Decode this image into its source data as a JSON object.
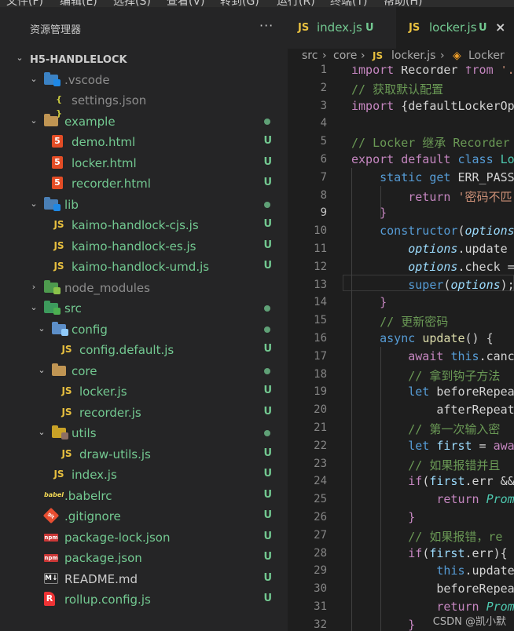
{
  "menubar": [
    "文件(F)",
    "编辑(E)",
    "选择(S)",
    "查看(V)",
    "转到(G)",
    "运行(R)",
    "终端(T)",
    "帮助(H)"
  ],
  "sidebar": {
    "title": "资源管理器",
    "more": "···",
    "root": "H5-HANDLELOCK",
    "items": [
      {
        "label": ".vscode",
        "status": ""
      },
      {
        "label": "settings.json",
        "status": ""
      },
      {
        "label": "example",
        "status": ""
      },
      {
        "label": "demo.html",
        "status": "U"
      },
      {
        "label": "locker.html",
        "status": "U"
      },
      {
        "label": "recorder.html",
        "status": "U"
      },
      {
        "label": "lib",
        "status": ""
      },
      {
        "label": "kaimo-handlock-cjs.js",
        "status": "U"
      },
      {
        "label": "kaimo-handlock-es.js",
        "status": "U"
      },
      {
        "label": "kaimo-handlock-umd.js",
        "status": "U"
      },
      {
        "label": "node_modules",
        "status": ""
      },
      {
        "label": "src",
        "status": ""
      },
      {
        "label": "config",
        "status": ""
      },
      {
        "label": "config.default.js",
        "status": "U"
      },
      {
        "label": "core",
        "status": ""
      },
      {
        "label": "locker.js",
        "status": "U"
      },
      {
        "label": "recorder.js",
        "status": "U"
      },
      {
        "label": "utils",
        "status": ""
      },
      {
        "label": "draw-utils.js",
        "status": "U"
      },
      {
        "label": "index.js",
        "status": "U"
      },
      {
        "label": ".babelrc",
        "status": "U"
      },
      {
        "label": ".gitignore",
        "status": "U"
      },
      {
        "label": "package-lock.json",
        "status": "U"
      },
      {
        "label": "package.json",
        "status": "U"
      },
      {
        "label": "README.md",
        "status": "U"
      },
      {
        "label": "rollup.config.js",
        "status": "U"
      }
    ]
  },
  "icons": {
    "js": "JS",
    "json": "{ }",
    "html": "5",
    "babel": "babel",
    "git": "git",
    "npm": "npm",
    "md": "M↓",
    "rollup": "R"
  },
  "tabs": [
    {
      "icon": "JS",
      "name": "index.js",
      "status": "U"
    },
    {
      "icon": "JS",
      "name": "locker.js",
      "status": "U",
      "close": "×"
    }
  ],
  "breadcrumb": {
    "p1": "src",
    "p2": "core",
    "p3": "locker.js",
    "p4": "Locker",
    "sep": "›",
    "js": "JS"
  },
  "editor": {
    "lines": [
      "1",
      "2",
      "3",
      "4",
      "5",
      "6",
      "7",
      "8",
      "9",
      "10",
      "11",
      "12",
      "13",
      "14",
      "15",
      "16",
      "17",
      "18",
      "19",
      "20",
      "21",
      "22",
      "23",
      "24",
      "25",
      "26",
      "27",
      "28",
      "29",
      "30",
      "31",
      "32"
    ],
    "code": [
      "import Recorder from '.",
      "// 获取默认配置",
      "import {defaultLockerOp",
      "",
      "// Locker 继承 Recorder",
      "export default class Lo",
      "    static get ERR_PASS",
      "        return '密码不匹",
      "    }",
      "    constructor(options",
      "        options.update",
      "        options.check =",
      "        super(options);",
      "    }",
      "    // 更新密码",
      "    async update() {",
      "        await this.canc",
      "        // 拿到钩子方法",
      "        let beforeRepea",
      "            afterRepeat",
      "        // 第一次输入密",
      "        let first = awa",
      "        // 如果报错并且",
      "        if(first.err &&",
      "            return Prom",
      "        }",
      "        // 如果报错，re",
      "        if(first.err){",
      "            this.update",
      "            beforeRepea",
      "            return Prom",
      "        }"
    ]
  },
  "watermark": "CSDN @凯小默"
}
